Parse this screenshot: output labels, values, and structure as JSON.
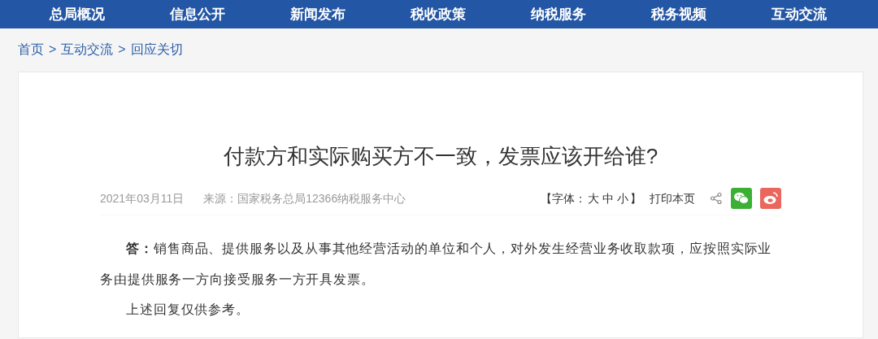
{
  "nav": [
    {
      "label": "总局概况"
    },
    {
      "label": "信息公开"
    },
    {
      "label": "新闻发布"
    },
    {
      "label": "税收政策"
    },
    {
      "label": "纳税服务"
    },
    {
      "label": "税务视频"
    },
    {
      "label": "互动交流"
    }
  ],
  "breadcrumb": [
    "首页",
    "互动交流",
    "回应关切"
  ],
  "breadcrumb_separator": ">",
  "article": {
    "title": "付款方和实际购买方不一致，发票应该开给谁?",
    "date": "2021年03月11日",
    "source": "来源：国家税务总局12366纳税服务中心",
    "font_size": {
      "open": "【字体：",
      "options": [
        "大",
        "中",
        "小"
      ],
      "close": "】"
    },
    "print": "打印本页",
    "paragraphs": [
      "**答：**销售商品、提供服务以及从事其他经营活动的单位和个人，对外发生经营业务收取款项，应按照实际业务由提供服务一方向接受服务一方开具发票。",
      "上述回复仅供参考。"
    ]
  }
}
